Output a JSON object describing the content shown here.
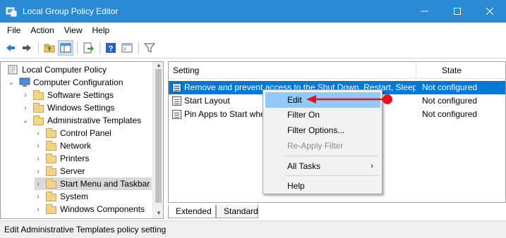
{
  "window": {
    "title": "Local Group Policy Editor",
    "title_bar_color": "#2a8ad4",
    "controls": {
      "minimize": "minimize-icon",
      "maximize": "maximize-icon",
      "close": "close-icon"
    }
  },
  "menubar": {
    "items": [
      {
        "label": "File"
      },
      {
        "label": "Action"
      },
      {
        "label": "View"
      },
      {
        "label": "Help"
      }
    ]
  },
  "toolbar": {
    "buttons": [
      "back-arrow-icon",
      "forward-arrow-icon",
      "up-folder-icon",
      "show-hide-tree-icon",
      "export-list-icon",
      "help-icon",
      "properties-icon",
      "filter-icon"
    ]
  },
  "tree": {
    "nodes": [
      {
        "label": "Local Computer Policy",
        "icon": "computer-policy-icon",
        "expand": ""
      },
      {
        "label": "Computer Configuration",
        "icon": "computer-icon",
        "expand": "⌄"
      },
      {
        "label": "Software Settings",
        "icon": "folder-icon",
        "expand": "›"
      },
      {
        "label": "Windows Settings",
        "icon": "folder-icon",
        "expand": "›"
      },
      {
        "label": "Administrative Templates",
        "icon": "folder-icon",
        "expand": "⌄"
      },
      {
        "label": "Control Panel",
        "icon": "folder-icon",
        "expand": "›"
      },
      {
        "label": "Network",
        "icon": "folder-icon",
        "expand": "›"
      },
      {
        "label": "Printers",
        "icon": "folder-icon",
        "expand": "›"
      },
      {
        "label": "Server",
        "icon": "folder-icon",
        "expand": "›"
      },
      {
        "label": "Start Menu and Taskbar",
        "icon": "folder-icon",
        "expand": "›"
      },
      {
        "label": "System",
        "icon": "folder-icon",
        "expand": "›"
      },
      {
        "label": "Windows Components",
        "icon": "folder-icon",
        "expand": "›"
      }
    ],
    "selected": "Start Menu and Taskbar"
  },
  "list": {
    "columns": [
      {
        "label": "Setting"
      },
      {
        "label": "State"
      }
    ],
    "rows": [
      {
        "name": "Remove and prevent access to the Shut Down, Restart, Sleep...",
        "state": "Not configured"
      },
      {
        "name": "Start Layout",
        "state": "Not configured"
      },
      {
        "name": "Pin Apps to Start when installed",
        "state": "Not configured"
      }
    ],
    "selected_index": 0
  },
  "tabs": [
    {
      "label": "Extended"
    },
    {
      "label": "Standard"
    }
  ],
  "context_menu": {
    "items": [
      {
        "label": "Edit",
        "state": "highlighted"
      },
      {
        "label": "Filter On",
        "state": "normal"
      },
      {
        "label": "Filter Options...",
        "state": "normal"
      },
      {
        "label": "Re-Apply Filter",
        "state": "disabled"
      },
      {
        "label": "All Tasks",
        "state": "submenu",
        "submenu_glyph": "›"
      },
      {
        "label": "Help",
        "state": "normal"
      }
    ],
    "highlight_color": "#91c9f7"
  },
  "annotation": {
    "arrow_color": "#e0141e"
  },
  "status_bar": {
    "text": "Edit Administrative Templates policy setting"
  }
}
